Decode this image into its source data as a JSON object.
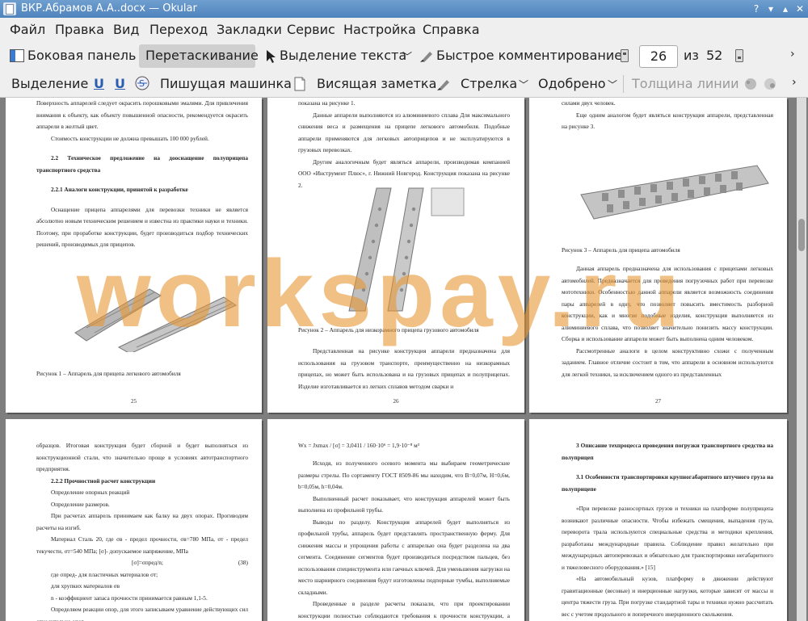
{
  "window": {
    "title": "ВКР.Абрамов А.А..docx  — Okular"
  },
  "menu": [
    "Файл",
    "Правка",
    "Вид",
    "Переход",
    "Закладки",
    "Сервис",
    "Настройка",
    "Справка"
  ],
  "toolbar1": {
    "sidebar": "Боковая панель",
    "drag": "Перетаскивание",
    "text_select": "Выделение текста",
    "quick_comment": "Быстрое комментирование",
    "page_current": "26",
    "of": "из",
    "page_total": "52"
  },
  "toolbar2": {
    "select": "Выделение",
    "typewriter": "Пишущая машинка",
    "note": "Висящая заметка",
    "arrow": "Стрелка",
    "approved": "Одобрено",
    "line_width": "Толщина линии"
  },
  "watermark": "workspay.ru",
  "pages": {
    "p25": {
      "lines": [
        "Поверхность аппарелей следует окрасить порошковыми эмалями. Для привлечения внимания к объекту, как объекту повышенной опасности, рекомендуется окрасить аппарели в желтый цвет.",
        "Стоимость конструкции не должна превышать 100 000 рублей.",
        "2.2 Техническое предложение на дооснащение полуприцепа транспортного средства",
        "2.2.1 Аналоги конструкции, принятой к разработке",
        "Оснащение прицепа аппарелями для перевозки техники не является абсолютно новым техническим решением и известна из практики науки и техники. Поэтому, при проработке конструкции, будет производиться подбор технических решений, производимых для прицепов."
      ],
      "caption": "Рисунок 1 – Аппарель для прицепа легкового автомобиля",
      "number": "25"
    },
    "p26": {
      "lines": [
        "показана на рисунке 1.",
        "Данные аппарели выполняются из алюминиевого сплава Для максимального снижения веса и размещения на прицепе легкового автомобиля. Подобные аппарели применяются для легковых автоприцепов и не эксплуатируются в грузовых перевозках.",
        "Другим аналогичным будет являться аппарели, производимая компанией ООО «Инструмент Плюс», г. Нижний Новгород. Конструкция показана на рисунке 2."
      ],
      "caption": "Рисунок 2 – Аппарель для низкорамного прицепа грузового автомобиля",
      "after": "Представленная на рисунке конструкция аппарели предназначена для использования на грузовом транспорте, преимущественно на низкорамных прицепах, но может быть использована и на грузовых прицепах и полуприцепах. Изделие изготавливается из легких сплавов методом сварки и",
      "number": "26"
    },
    "p27": {
      "lines": [
        "силами двух человек.",
        "Еще одним аналогом будет являться конструкция аппарели, представленная на рисунке 3."
      ],
      "caption": "Рисунок 3 – Аппарель для прицепа автомобиля",
      "after": [
        "Данная аппарель предназначена для использования с прицепами легковых автомобилей. Предназначается для проведения погрузочных работ при перевозке мототехники. Особенностью данной аппарели является возможность соединения пары аппарелей в одну, что позволяет повысить вместимость разборной конструкции, как и многие подобные изделия, конструкция выполняется из алюминиевого сплава, что позволяет значительно понизить массу конструкции. Сборка и использование аппарели может быть выполнена одним человеком.",
        "Рассмотренные аналоги в целом конструктивно схожи с полученным заданием. Главное отличие состоит в том, что аппарели в основном используются для легкой техники, за исключением одного из представленных"
      ],
      "number": "27"
    },
    "p28": {
      "lines": [
        "образцов. Итоговая конструкция будет сборной и будет выполняться из конструкционной стали, что значительно проще в условиях автотранспортного предприятия.",
        "2.2.2 Прочностной расчет конструкции",
        "Определение опорных реакций",
        "Определение размеров.",
        "При расчетах аппарель принимаем как балку на двух опорах. Прогиводим расчеты на изгиб.",
        "Материал Сталь 20, где σв - предел прочности, σв=780 МПа, σт - предел текучести, σт=540 МПа; [σ]- допускаемое напряжение, МПа",
        "[σ]=σпред/n;",
        "(38)",
        "где σпред- для пластичных материалов σт;",
        "для хрупких материалов σв",
        "n - коэффициент запаса прочности  принимается равным 1,1-5.",
        "Определяем реакции опор, для этого записываем уравнение действующих сил относительно опор."
      ]
    },
    "p29": {
      "formula": "Wx = Jxmax / [σ] = 3,0411 / 160·10⁶ = 1,9·10⁻⁸ м³",
      "lines": [
        "Исходя, из полученного осевого момента мы выбираем геометрические размеры стрелы. По сортаменту ГОСТ 8509-86 мы находим, что В=0,07м, Н=0,6м, b=0,05м, h=0,04м.",
        "Выполненный расчет показывает, что конструкция аппарелей может быть выполнена из профильной трубы.",
        "Выводы по разделу. Конструкция аппарелей будет выполняться из профильной трубы, аппарель будет представлять пространственную ферму. Для снижения массы и упрощения работы с аппарелью она будет разделена на два сегмента. Соединение сегментов будет производиться посредством пальцев, без использования специнструмента или гаечных ключей. Для уменьшения нагрузки на место шарнирного соединения будут изготовлены подпорные тумбы, выполняемые складными.",
        "Проведенные в разделе расчеты показали, что при проектировании конструкции полностью соблюдаются требования к прочности конструкции, а данные, разработанная конструкция соответствует требованиям надежности и"
      ]
    },
    "p30": {
      "lines": [
        "3 Описание техпроцесса проведения погрузки транспортного средства на полуприцеп",
        "3.1 Особенности транспортировки крупногабаритного штучного груза на полуприцепе",
        "«При перевозке разносортных грузов и техники на платформе полуприцепа возникают различные опасности. Чтобы избежать смещения, выпадения груза, переворота трала используются специальные средства и методики крепления, разработаны международные правила. Соблюдение правил желательно при международных автоперевозках и обязательно для транспортировки негабаритного и тяжеловесного оборудования.» [15]",
        "«На автомобильный кузов, платформу в движении действуют гравитационные (весовые) и инерционные нагрузки, которые зависят от массы и центра тяжести груза. При погрузке стандартной тары и техники нужно рассчитать вес с учетом продольного и поперечного инерционного скольжения."
      ]
    }
  }
}
